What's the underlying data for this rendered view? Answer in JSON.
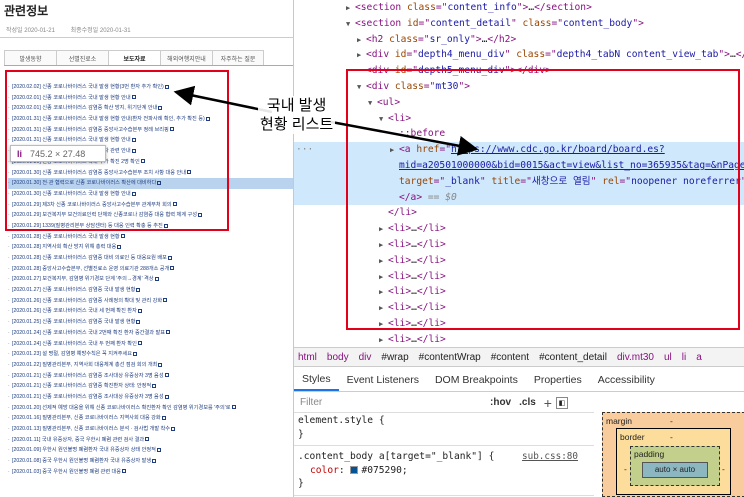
{
  "page": {
    "title": "관련정보",
    "meta_posted": "작성일 2020-01-21",
    "meta_updated": "최종수정일 2020-01-31",
    "tabs": [
      "발생동향",
      "선별진료소",
      "보도자료",
      "해외여행지안내",
      "자주하는 질문"
    ],
    "active_tab": 2,
    "news": [
      "[2020.02.02] 신종 코로나바이러스 국내 발생 현황(3번 환자 추가 확인)",
      "[2020.02.01] 신종 코로나바이러스 국내 발생 현황 안내",
      "[2020.02.01] 신종 코로나바이러스 감염증 확산 방지, 위기단계 안내",
      "[2020.01.31] 신종 코로나바이러스 국내 발생 현황 안내(환자 전파사례 확인, 추가 확진 등)",
      "[2020.01.31] 신종 코로나바이러스 감염증 중앙사고수습본부 정례 브리핑",
      "[2020.01.31] 신종 코로나바이러스 국내 발생 현황 안내",
      "[2020.01.30] 신종 코로나바이러스 확진 환자 관련 안내",
      "[2020.01.30] 신종 코로나바이러스 국내 추가 확진 2명 확인",
      "[2020.01.30] 신종 코로나바이러스 감염증 중앙사고수습본부 조치 사항 대응 안내",
      "[2020.01.30] 전·관 협력으로 신종 코로나바이러스 확산에 대비하다",
      "[2020.01.30] 신종 코로나바이러스 국내 발생 현황 안내",
      "[2020.01.29] 제3차 신종 코로나바이러스 중앙사고수습본부 관계부처 회의",
      "[2020.01.29] 보건복지부 보건의료인력 단체와 신종코로나 감염증 대응 협력 체계 구성",
      "[2020.01.29] 1339(질병관리본부 상담센터) 등 대응 인력 확충 등 추진",
      "[2020.01.28] 신종 코로나바이러스 국내 발생 현황",
      "[2020.01.28] 지역사회 확산 방지 위해 총력 대응",
      "[2020.01.28] 신종 코로나바이러스 감염증 대비 의료인 등 대응요원 배포",
      "[2020.01.28] 중앙사고수습본부, 선별진료소 운영 의료기관 288개소 공개",
      "[2020.01.27] 보건복지부, 감염병 위기경보 단계 '주의→경계' 격상",
      "[2020.01.27] 신종 코로나바이러스 감염증 국내 발생 현황",
      "[2020.01.26] 신종 코로나바이러스 감염증 사례정의 확대 및 관리 강화",
      "[2020.01.26] 신종 코로나바이러스 국내 세 번째 확진 환자",
      "[2020.01.25] 신종 코로나바이러스 감염증 국내 발생 현황",
      "[2020.01.24] 신종 코로나바이러스 국내 2번째 확진 환자 중간결과 발표",
      "[2020.01.24] 신종 코로나바이러스 국내 두 번째 환자 확인",
      "[2020.01.23] 설 명절, 감염병 예방수칙은 꼭 지켜주세요",
      "[2020.01.22] 질병관리본부, 지역사회 대응체계 총선 점검 회의 개최",
      "[2020.01.21] 신종 코로나바이러스 감염증 조사대상 유증상자 3명 음성",
      "[2020.01.21] 신종 코로나바이러스 감염증 확진환자 상태: 안정적",
      "[2020.01.21] 신종 코로나바이러스 감염증 조사대상 유증상자 3명 음성",
      "[2020.01.20] 선제적 예방 대응을 위해 신종 코로나바이러스 확진환자 확인 감염병 위기경보를 '주의'로",
      "[2020.01.16] 질병관리본부, 신종 코로나바이러스 지역사회 대응 강화",
      "[2020.01.13] 질병관리본부, 신종 코로나바이러스 분석 · 검사법 개발 착수",
      "[2020.01.11] 국내 유증상자, 중국 우한시 폐렴 관련 검사 결과",
      "[2020.01.09] 우한시 원인불명 폐렴환자 국내 유증상자 상태 안정적",
      "[2020.01.08] 중국 우한시 원인불명 폐렴환자 국내 유증상자 발생",
      "[2020.01.03] 중국 우한시 원인불명 폐렴 관련 대응"
    ],
    "highlighted_index": 9,
    "tooltip_tag": "li",
    "tooltip_size": "745.2 × 27.48"
  },
  "annotation": "국내 발생\n현황 리스트",
  "dom": {
    "lines": [
      {
        "type": "raw",
        "indent": 0,
        "arrow": "▶",
        "parts": [
          [
            "t",
            "<section "
          ],
          [
            "an",
            "class"
          ],
          [
            "t",
            "=\""
          ],
          [
            "av",
            "content_info"
          ],
          [
            "t",
            "\">"
          ],
          [
            "txt",
            "…"
          ],
          [
            "t",
            "</section>"
          ]
        ]
      },
      {
        "type": "raw",
        "indent": 0,
        "arrow": "▼",
        "parts": [
          [
            "t",
            "<section "
          ],
          [
            "an",
            "id"
          ],
          [
            "t",
            "=\""
          ],
          [
            "av",
            "content_detail"
          ],
          [
            "t",
            "\" "
          ],
          [
            "an",
            "class"
          ],
          [
            "t",
            "=\""
          ],
          [
            "av",
            "content_body"
          ],
          [
            "t",
            "\">"
          ]
        ]
      },
      {
        "type": "raw",
        "indent": 1,
        "arrow": "▶",
        "parts": [
          [
            "t",
            "<h2 "
          ],
          [
            "an",
            "class"
          ],
          [
            "t",
            "=\""
          ],
          [
            "av",
            "sr_only"
          ],
          [
            "t",
            "\">"
          ],
          [
            "txt",
            "…"
          ],
          [
            "t",
            "</h2>"
          ]
        ]
      },
      {
        "type": "raw",
        "indent": 1,
        "arrow": "▶",
        "parts": [
          [
            "t",
            "<div "
          ],
          [
            "an",
            "id"
          ],
          [
            "t",
            "=\""
          ],
          [
            "av",
            "depth4_menu_div"
          ],
          [
            "t",
            "\" "
          ],
          [
            "an",
            "class"
          ],
          [
            "t",
            "=\""
          ],
          [
            "av",
            "depth4_tabN content_view_tab"
          ],
          [
            "t",
            "\">"
          ],
          [
            "txt",
            "…"
          ],
          [
            "t",
            "</div>"
          ]
        ]
      },
      {
        "type": "raw",
        "indent": 1,
        "arrow": "",
        "parts": [
          [
            "t",
            "<div "
          ],
          [
            "an",
            "id"
          ],
          [
            "t",
            "=\""
          ],
          [
            "av",
            "depth5_menu_div"
          ],
          [
            "t",
            "\">"
          ],
          [
            "t",
            "</div>"
          ]
        ]
      },
      {
        "type": "raw",
        "indent": 1,
        "arrow": "▼",
        "parts": [
          [
            "t",
            "<div "
          ],
          [
            "an",
            "class"
          ],
          [
            "t",
            "=\""
          ],
          [
            "av",
            "mt30"
          ],
          [
            "t",
            "\">"
          ]
        ]
      },
      {
        "type": "raw",
        "indent": 2,
        "arrow": "▼",
        "parts": [
          [
            "t",
            "<ul>"
          ]
        ]
      },
      {
        "type": "raw",
        "indent": 3,
        "arrow": "▼",
        "parts": [
          [
            "t",
            "<li>"
          ]
        ]
      },
      {
        "type": "raw",
        "indent": 4,
        "arrow": "",
        "parts": [
          [
            "ps",
            "::before"
          ]
        ]
      },
      {
        "type": "sel",
        "indent": 4,
        "arrow": "▶",
        "parts": [
          [
            "t",
            "<a "
          ],
          [
            "an",
            "href"
          ],
          [
            "t",
            "=\""
          ],
          [
            "url",
            "https://www.cdc.go.kr/board/board.es?"
          ]
        ]
      },
      {
        "type": "sel",
        "indent": 4,
        "arrow": "",
        "parts": [
          [
            "url",
            "mid=a20501000000&bid=0015&act=view&list_no=365935&tag=&nPage=1"
          ],
          [
            "t",
            "\""
          ]
        ]
      },
      {
        "type": "sel",
        "indent": 4,
        "arrow": "",
        "parts": [
          [
            "an",
            "target"
          ],
          [
            "t",
            "=\""
          ],
          [
            "av",
            "_blank"
          ],
          [
            "t",
            "\" "
          ],
          [
            "an",
            "title"
          ],
          [
            "t",
            "=\""
          ],
          [
            "av",
            "새창으로 열림"
          ],
          [
            "t",
            "\" "
          ],
          [
            "an",
            "rel"
          ],
          [
            "t",
            "=\""
          ],
          [
            "av",
            "noopener noreferrer"
          ],
          [
            "t",
            "\">"
          ]
        ]
      },
      {
        "type": "sel",
        "indent": 4,
        "arrow": "",
        "parts": [
          [
            "t",
            "</a>"
          ],
          [
            "eq",
            " == $0"
          ]
        ]
      },
      {
        "type": "raw",
        "indent": 3,
        "arrow": "",
        "parts": [
          [
            "t",
            "</li>"
          ]
        ]
      },
      {
        "type": "raw",
        "indent": 3,
        "arrow": "▶",
        "parts": [
          [
            "t",
            "<li>"
          ],
          [
            "txt",
            "…"
          ],
          [
            "t",
            "</li>"
          ]
        ]
      },
      {
        "type": "raw",
        "indent": 3,
        "arrow": "▶",
        "parts": [
          [
            "t",
            "<li>"
          ],
          [
            "txt",
            "…"
          ],
          [
            "t",
            "</li>"
          ]
        ]
      },
      {
        "type": "raw",
        "indent": 3,
        "arrow": "▶",
        "parts": [
          [
            "t",
            "<li>"
          ],
          [
            "txt",
            "…"
          ],
          [
            "t",
            "</li>"
          ]
        ]
      },
      {
        "type": "raw",
        "indent": 3,
        "arrow": "▶",
        "parts": [
          [
            "t",
            "<li>"
          ],
          [
            "txt",
            "…"
          ],
          [
            "t",
            "</li>"
          ]
        ]
      },
      {
        "type": "raw",
        "indent": 3,
        "arrow": "▶",
        "parts": [
          [
            "t",
            "<li>"
          ],
          [
            "txt",
            "…"
          ],
          [
            "t",
            "</li>"
          ]
        ]
      },
      {
        "type": "raw",
        "indent": 3,
        "arrow": "▶",
        "parts": [
          [
            "t",
            "<li>"
          ],
          [
            "txt",
            "…"
          ],
          [
            "t",
            "</li>"
          ]
        ]
      },
      {
        "type": "raw",
        "indent": 3,
        "arrow": "▶",
        "parts": [
          [
            "t",
            "<li>"
          ],
          [
            "txt",
            "…"
          ],
          [
            "t",
            "</li>"
          ]
        ]
      },
      {
        "type": "raw",
        "indent": 3,
        "arrow": "▶",
        "parts": [
          [
            "t",
            "<li>"
          ],
          [
            "txt",
            "…"
          ],
          [
            "t",
            "</li>"
          ]
        ]
      },
      {
        "type": "raw",
        "indent": 3,
        "arrow": "▶",
        "parts": [
          [
            "t",
            "<li>"
          ],
          [
            "txt",
            "…"
          ],
          [
            "t",
            "</li>"
          ]
        ]
      }
    ]
  },
  "breadcrumbs": [
    "html",
    "body",
    "div",
    "#wrap",
    "#contentWrap",
    "#content",
    "#content_detail",
    "div.mt30",
    "ul",
    "li",
    "a"
  ],
  "styles_tabs": [
    "Styles",
    "Event Listeners",
    "DOM Breakpoints",
    "Properties",
    "Accessibility"
  ],
  "active_styles_tab": 0,
  "filter": {
    "placeholder": "Filter",
    "hov": ":hov",
    "cls": ".cls",
    "plus": "+"
  },
  "rules": [
    {
      "selector": "element.style {",
      "source": ""
    },
    {
      "prop": "",
      "value": "}",
      "close": true
    },
    {
      "selector": ".content_body a[target=\"_blank\"] {",
      "source": "sub.css:80"
    },
    {
      "prop": "color",
      "value": "#075290;",
      "swatch": "#075290"
    },
    {
      "prop": "",
      "value": "}",
      "close": true
    },
    {
      "selector": ".content_body a[target=\"_blank\"] {",
      "source": "sub.css:80"
    }
  ],
  "boxmodel": {
    "margin": "margin",
    "border": "border",
    "padding": "padding",
    "content": "auto × auto",
    "dash": "-"
  }
}
